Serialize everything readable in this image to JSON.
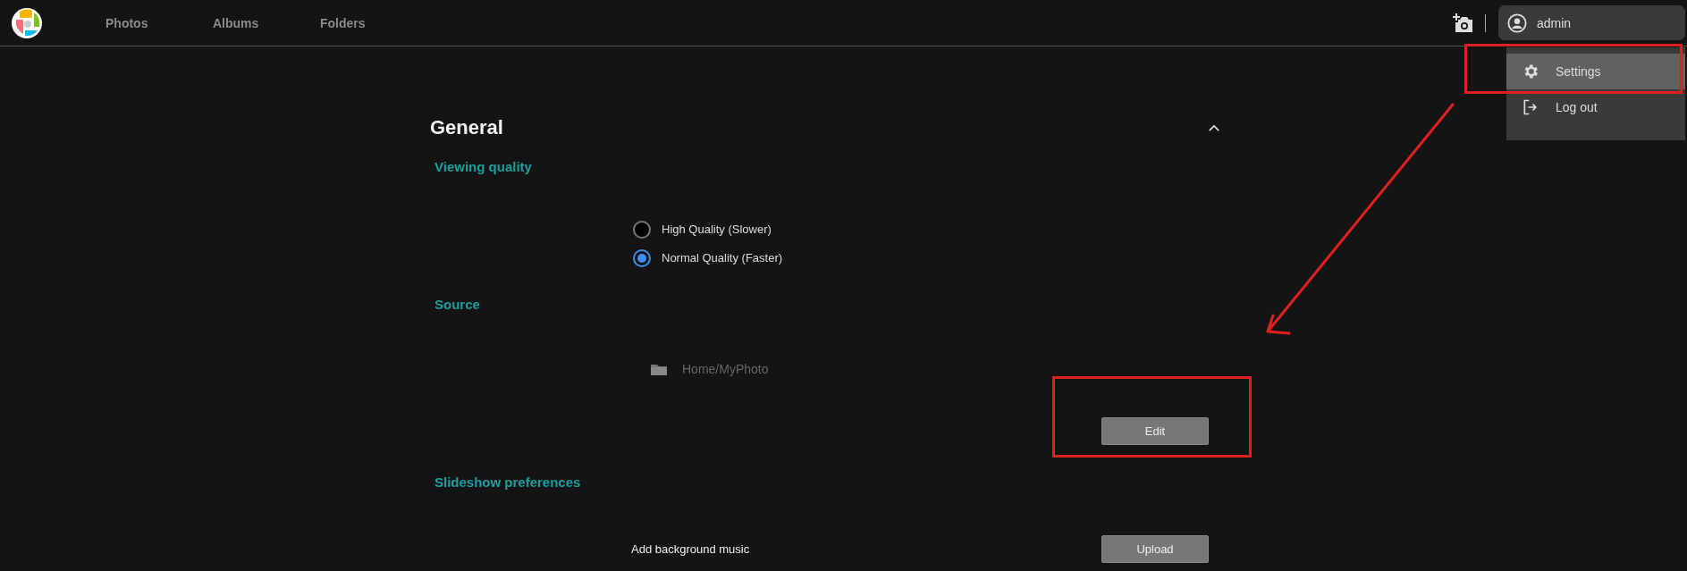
{
  "nav": {
    "items": [
      {
        "label": "Photos"
      },
      {
        "label": "Albums"
      },
      {
        "label": "Folders"
      }
    ]
  },
  "user_menu": {
    "username": "admin",
    "items": [
      {
        "kind": "settings",
        "label": "Settings",
        "selected": true
      },
      {
        "kind": "logout",
        "label": "Log out",
        "selected": false
      }
    ]
  },
  "panel": {
    "title": "General",
    "expanded": true,
    "sections": [
      {
        "kind": "radio",
        "heading": "Viewing quality",
        "options": [
          {
            "label": "High Quality (Slower)",
            "selected": false
          },
          {
            "label": "Normal Quality (Faster)",
            "selected": true
          }
        ]
      },
      {
        "kind": "source",
        "heading": "Source",
        "path": "Home/MyPhoto",
        "button": "Edit"
      },
      {
        "kind": "action",
        "heading": "Slideshow preferences",
        "label": "Add background music",
        "button": "Upload"
      }
    ]
  }
}
